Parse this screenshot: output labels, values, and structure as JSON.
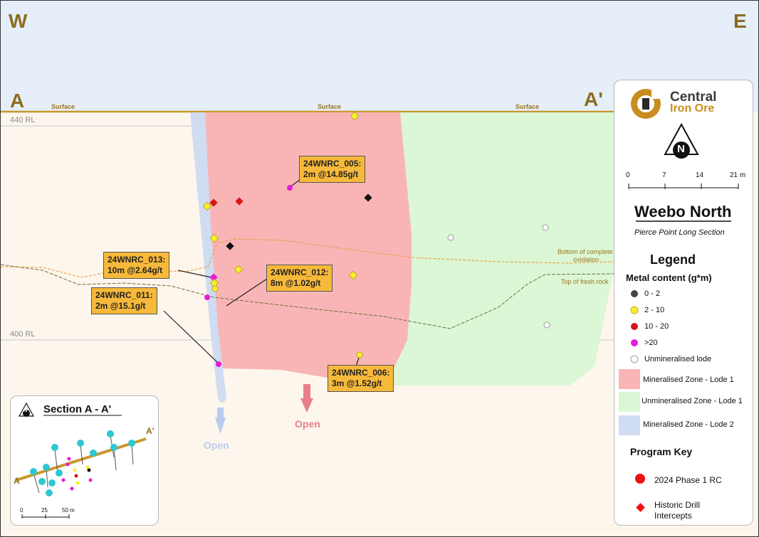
{
  "section": {
    "west": "W",
    "east": "E",
    "start": "A",
    "end": "A'",
    "surface_labels": [
      "Surface",
      "Surface",
      "Surface"
    ],
    "rl_labels": [
      "440 RL",
      "400 RL"
    ],
    "layers": {
      "oxidation": "Bottom of complete oxidation",
      "oxidation_line1": "Bottom of complete",
      "oxidation_line2": "oxidation",
      "fresh_rock": "Top of fresh rock"
    },
    "open_labels": {
      "lode2": "Open",
      "lode1": "Open"
    }
  },
  "callouts": [
    {
      "hole": "24WNRC_005:",
      "result": "2m @14.85g/t"
    },
    {
      "hole": "24WNRC_013:",
      "result": "10m @2.64g/t"
    },
    {
      "hole": "24WNRC_012:",
      "result": "8m @1.02g/t"
    },
    {
      "hole": "24WNRC_011:",
      "result": "2m @15.1g/t"
    },
    {
      "hole": "24WNRC_006:",
      "result": "3m @1.52g/t"
    }
  ],
  "legend": {
    "company_line1": "Central",
    "company_line2": "Iron Ore",
    "north": "N",
    "scale_ticks": [
      "0",
      "7",
      "14",
      "21 m"
    ],
    "title": "Weebo North",
    "subtitle": "Pierce Point Long Section",
    "legend_heading": "Legend",
    "metal_heading": "Metal content (g*m)",
    "metal_classes": [
      {
        "label": "0 - 2",
        "color": "#444444"
      },
      {
        "label": "2 - 10",
        "color": "#f7f02a"
      },
      {
        "label": "10 - 20",
        "color": "#d91515"
      },
      {
        "label": ">20",
        "color": "#e81ad9"
      },
      {
        "label": "Unmineralised lode",
        "color": "#ffffff"
      }
    ],
    "zones": [
      {
        "label": "Mineralised Zone - Lode 1",
        "color": "#f9b5b5"
      },
      {
        "label": "Unmineralised Zone - Lode 1",
        "color": "#d9f7d4"
      },
      {
        "label": "Mineralised Zone - Lode 2",
        "color": "#cfdcf2"
      }
    ],
    "program_heading": "Program Key",
    "programs": [
      {
        "label": "2024 Phase 1 RC",
        "color": "#ee1111"
      },
      {
        "label_line1": "Historic Drill",
        "label_line2": "Intercepts",
        "color": "#ee1111"
      }
    ]
  },
  "inset": {
    "title": "Section A - A'",
    "north": "N",
    "start": "A",
    "end": "A'",
    "scale_ticks": [
      "0",
      "25",
      "50 m"
    ]
  }
}
